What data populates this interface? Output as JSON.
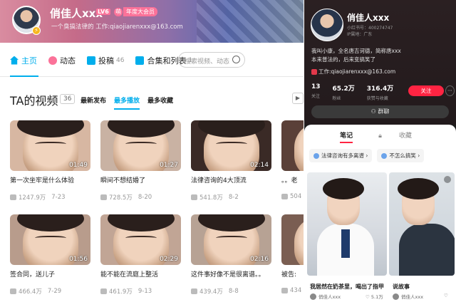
{
  "left": {
    "header": {
      "username": "俏佳人xxx",
      "level": "LV6",
      "year_badge": "年度大会员",
      "signature": "一个臭搞法律的  工作:qiaojiarenxxx@163.com"
    },
    "nav": {
      "items": [
        {
          "label": "主页",
          "count": ""
        },
        {
          "label": "动态",
          "count": ""
        },
        {
          "label": "投稿",
          "count": "46"
        },
        {
          "label": "合集和列表",
          "count": "1"
        }
      ],
      "search_placeholder": "搜索视频、动态"
    },
    "section": {
      "title": "TA的视频",
      "count": "36",
      "sorts": [
        "最新发布",
        "最多播放",
        "最多收藏"
      ]
    },
    "videos": [
      {
        "title": "第一次坐牢是什么体验",
        "duration": "01:49",
        "views": "1247.9万",
        "date": "7-23"
      },
      {
        "title": "瞬间不想结婚了",
        "duration": "01:27",
        "views": "728.5万",
        "date": "8-20"
      },
      {
        "title": "法律咨询的4大顶流",
        "duration": "02:14",
        "views": "541.8万",
        "date": "8-2"
      },
      {
        "title": "。。老",
        "duration": "",
        "views": "504",
        "date": ""
      },
      {
        "title": "签合同，送儿子",
        "duration": "01:56",
        "views": "466.4万",
        "date": "7-29"
      },
      {
        "title": "能不能在流庭上整活",
        "duration": "02:29",
        "views": "461.9万",
        "date": "9-13"
      },
      {
        "title": "这件事好像不是很离谱。。",
        "duration": "02:16",
        "views": "439.4万",
        "date": "8-8"
      },
      {
        "title": "被告:",
        "duration": "",
        "views": "434",
        "date": ""
      }
    ]
  },
  "right": {
    "name": "俏佳人xxx",
    "id_line": "小红书号：400274747",
    "location": "IP属地：广东",
    "bio_line1": "我叫小康，全名唐吉诃德，简称唐xxx",
    "bio_line2": "本来普法的，后来变搞笑了",
    "work": "工作:qiaojiarenxxx@163.com",
    "stats": [
      {
        "num": "13",
        "label": "关注"
      },
      {
        "num": "65.2万",
        "label": "粉丝"
      },
      {
        "num": "316.4万",
        "label": "获赞与收藏"
      }
    ],
    "follow_label": "关注",
    "group_label": "群聊",
    "tabs": [
      "笔记",
      "收藏"
    ],
    "tags": [
      "法律咨询有多离谱",
      "不怎么搞笑"
    ],
    "notes": [
      {
        "title": "我居然在奶茶里，喝出了指甲",
        "author": "俏佳人xxx",
        "likes": "5.1万"
      },
      {
        "title": "说故事",
        "author": "俏佳人xxx",
        "likes": ""
      }
    ]
  }
}
